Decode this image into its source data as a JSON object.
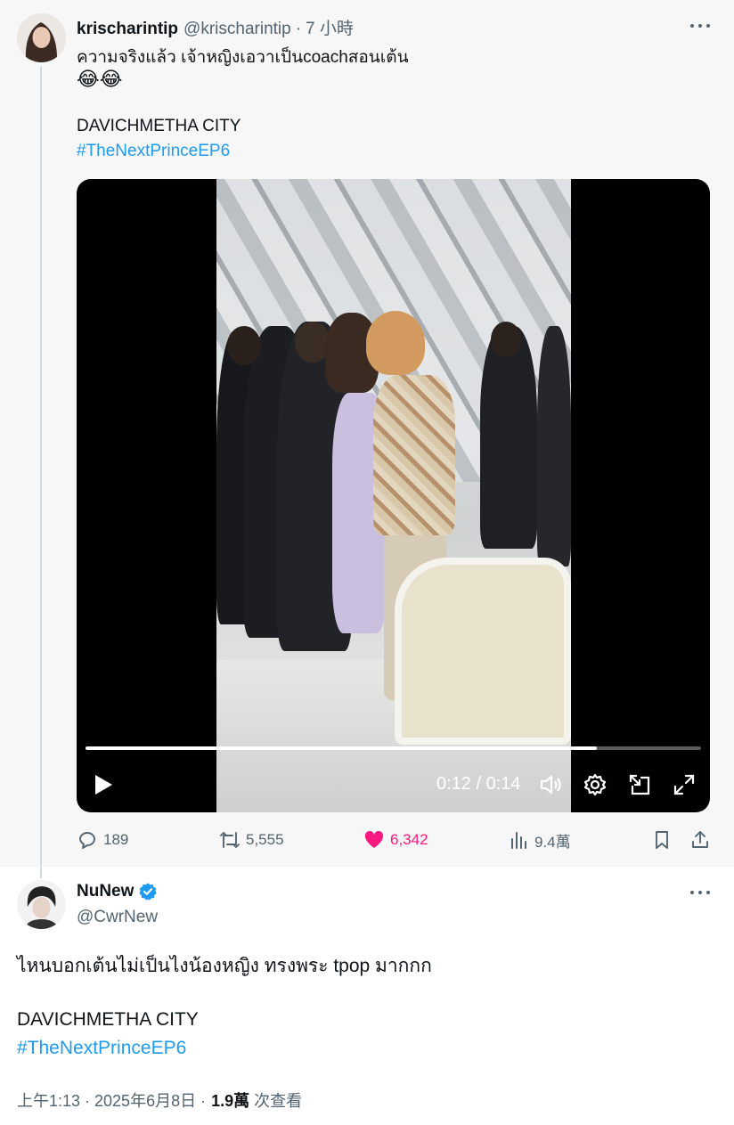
{
  "parent_tweet": {
    "display_name": "krischarintip",
    "handle": "@krischarintip",
    "separator": "·",
    "relative_time": "7 小時",
    "text_line1": "ความจริงแล้ว เจ้าหญิงเอวาเป็นcoachสอนเต้น",
    "emoji": "😂😂",
    "text_line2": "DAVICHMETHA CITY",
    "hashtag": "#TheNextPrinceEP6",
    "video": {
      "time_display": "0:12 / 0:14",
      "progress": 0.83
    },
    "actions": {
      "replies": "189",
      "reposts": "5,555",
      "likes": "6,342",
      "views": "9.4萬"
    }
  },
  "main_tweet": {
    "display_name": "NuNew",
    "handle": "@CwrNew",
    "verified": true,
    "text_line1": "ไหนบอกเต้นไม่เป็นไงน้องหญิง ทรงพระ tpop มากกก",
    "text_line2": "DAVICHMETHA CITY",
    "hashtag": "#TheNextPrinceEP6",
    "timestamp": "上午1:13 · 2025年6月8日 ·",
    "views_count": "1.9萬",
    "views_label": "次查看"
  },
  "colors": {
    "link": "#1d9bf0",
    "like": "#f91880",
    "muted": "#536471",
    "verified": "#1d9bf0"
  }
}
